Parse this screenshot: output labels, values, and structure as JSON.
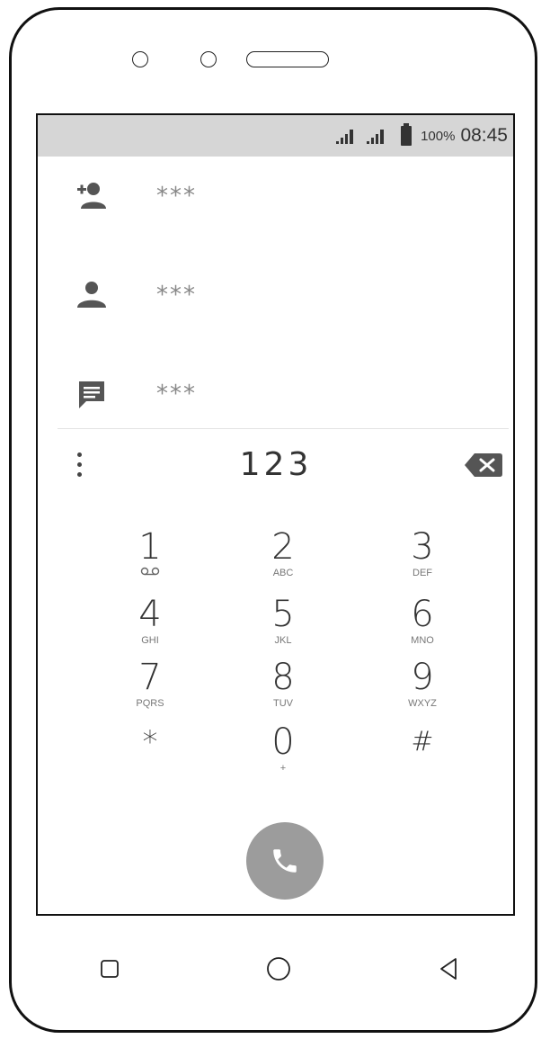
{
  "status_bar": {
    "battery_percent": "100%",
    "time": "08:45"
  },
  "suggestions": [
    {
      "icon": "add-contact-icon",
      "label": "***"
    },
    {
      "icon": "person-icon",
      "label": "***"
    },
    {
      "icon": "message-icon",
      "label": "***"
    }
  ],
  "dialer": {
    "number": "123",
    "keys": [
      {
        "digit": "1",
        "letters": ""
      },
      {
        "digit": "2",
        "letters": "ABC"
      },
      {
        "digit": "3",
        "letters": "DEF"
      },
      {
        "digit": "4",
        "letters": "GHI"
      },
      {
        "digit": "5",
        "letters": "JKL"
      },
      {
        "digit": "6",
        "letters": "MNO"
      },
      {
        "digit": "7",
        "letters": "PQRS"
      },
      {
        "digit": "8",
        "letters": "TUV"
      },
      {
        "digit": "9",
        "letters": "WXYZ"
      },
      {
        "digit": "*",
        "letters": ""
      },
      {
        "digit": "0",
        "letters": "+"
      },
      {
        "digit": "#",
        "letters": ""
      }
    ]
  },
  "colors": {
    "status_bar_bg": "#d6d6d6",
    "call_button": "#9c9c9c",
    "text": "#333333"
  }
}
